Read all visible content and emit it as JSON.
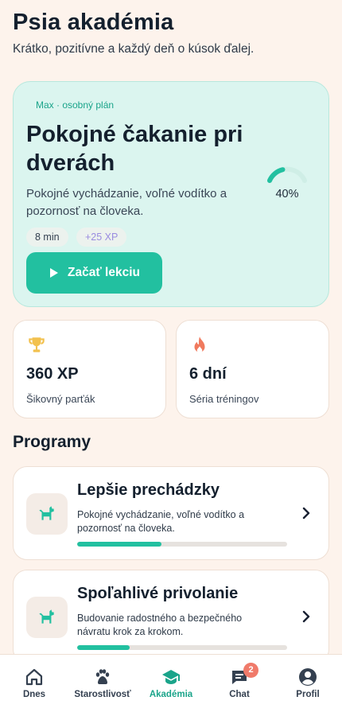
{
  "header": {
    "title": "Psia akadémia",
    "subtitle": "Krátko, pozitívne a každý deň o kúsok ďalej."
  },
  "hero": {
    "kicker": "Max · osobný plán",
    "title": "Pokojné čakanie pri dverách",
    "description": "Pokojné vychádzanie, voľné vodítko a pozornosť na človeka.",
    "duration": "8 min",
    "xp": "+25 XP",
    "progress_text": "40%",
    "progress_fraction": 0.4,
    "start_label": "Začať lekciu"
  },
  "stats": [
    {
      "icon": "trophy-icon",
      "value": "360 XP",
      "label": "Šikovný parťák",
      "color": "#f2c14e"
    },
    {
      "icon": "fire-icon",
      "value": "6 dní",
      "label": "Séria tréningov",
      "color": "#f07a5e"
    }
  ],
  "programs_title": "Programy",
  "programs": [
    {
      "title": "Lepšie prechádzky",
      "description": "Pokojné vychádzanie, voľné vodítko a pozornosť na človeka.",
      "progress": 0.4,
      "icon": "dog-icon"
    },
    {
      "title": "Spoľahlivé privolanie",
      "description": "Budovanie radostného a bezpečného návratu krok za krokom.",
      "progress": 0.25,
      "icon": "dog-icon"
    }
  ],
  "tabs": [
    {
      "label": "Dnes",
      "icon": "home-icon"
    },
    {
      "label": "Starostlivosť",
      "icon": "paw-icon"
    },
    {
      "label": "Akadémia",
      "icon": "graduation-cap-icon",
      "active": true
    },
    {
      "label": "Chat",
      "icon": "chat-icon",
      "badge": "2"
    },
    {
      "label": "Profil",
      "icon": "user-icon"
    }
  ],
  "colors": {
    "accent": "#22c0a0",
    "background": "#fdf3ec",
    "hero_background": "#dbf5ef",
    "badge": "#f07a6a"
  }
}
